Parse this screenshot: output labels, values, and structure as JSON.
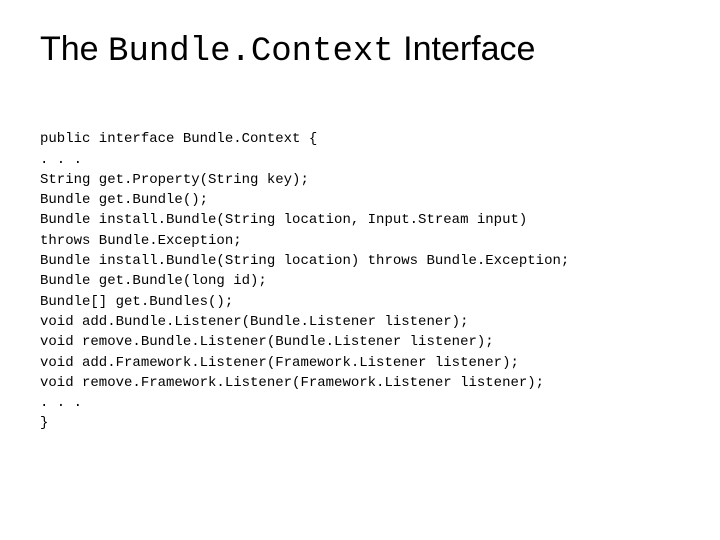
{
  "title": {
    "word1": "The ",
    "code": "Bundle.Context",
    "word2": " Interface"
  },
  "code_lines": [
    "public interface Bundle.Context {",
    ". . .",
    "String get.Property(String key);",
    "Bundle get.Bundle();",
    "Bundle install.Bundle(String location, Input.Stream input)",
    "throws Bundle.Exception;",
    "Bundle install.Bundle(String location) throws Bundle.Exception;",
    "Bundle get.Bundle(long id);",
    "Bundle[] get.Bundles();",
    "void add.Bundle.Listener(Bundle.Listener listener);",
    "void remove.Bundle.Listener(Bundle.Listener listener);",
    "void add.Framework.Listener(Framework.Listener listener);",
    "void remove.Framework.Listener(Framework.Listener listener);",
    ". . .",
    "}"
  ]
}
